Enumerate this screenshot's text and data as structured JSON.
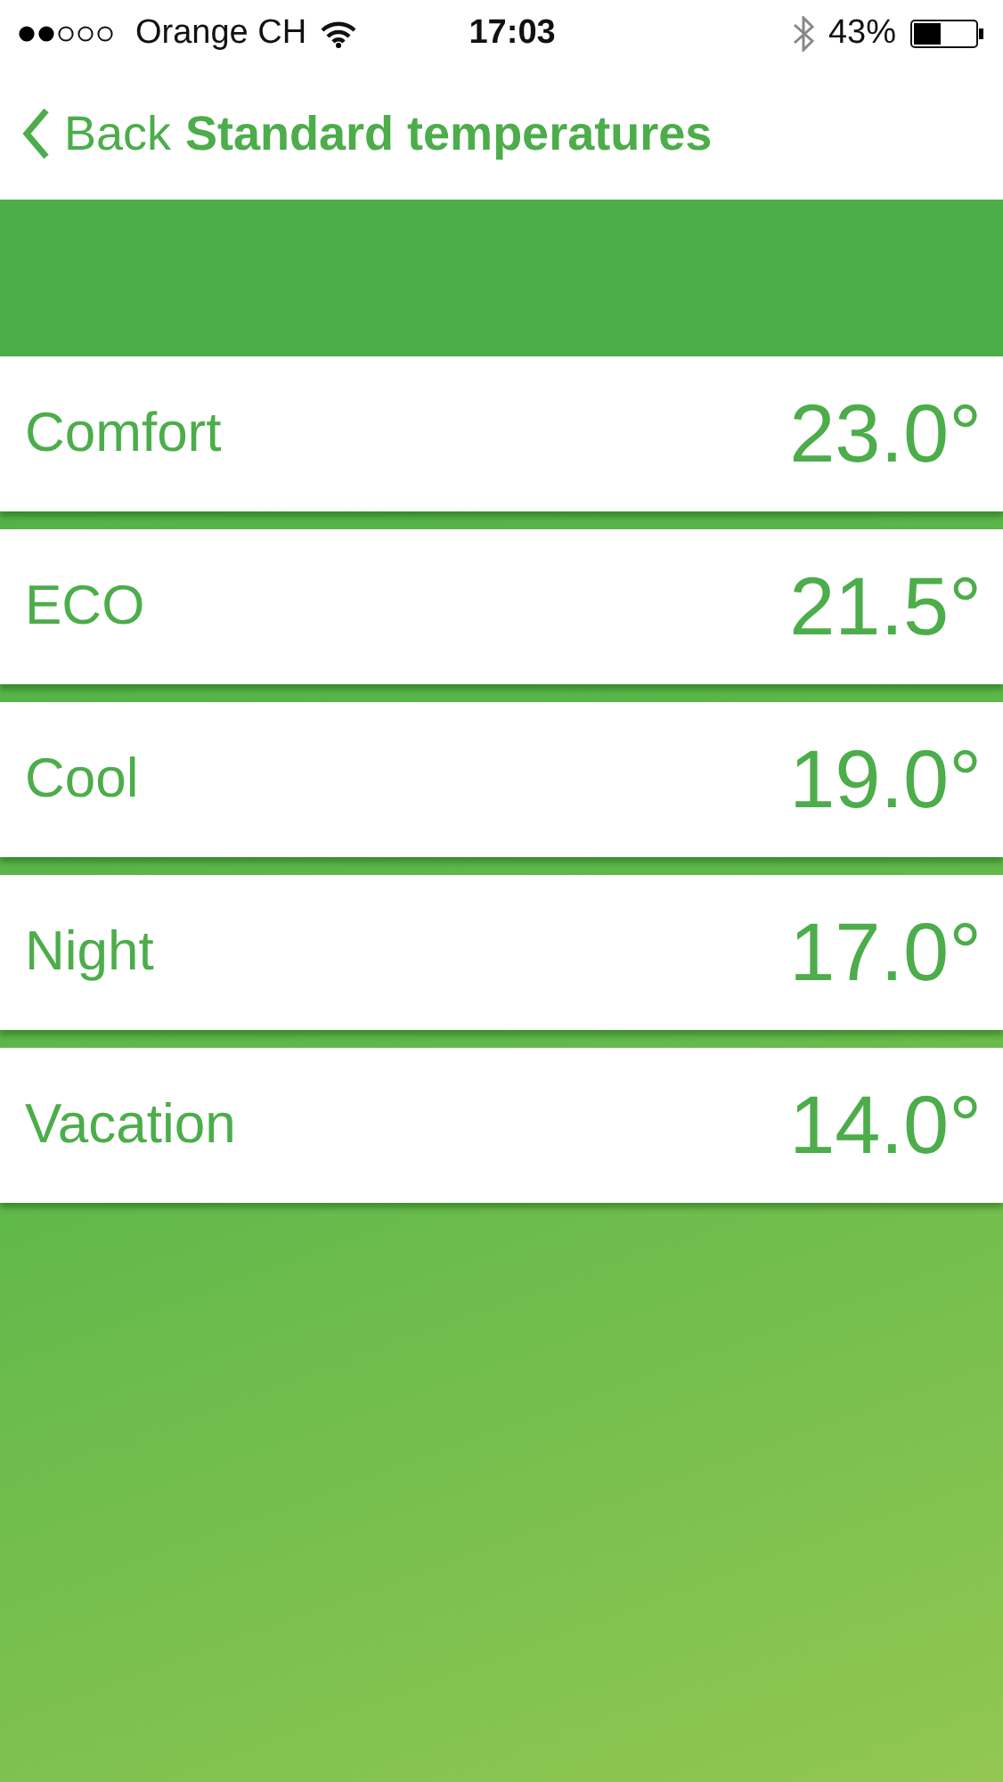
{
  "status_bar": {
    "carrier": "Orange CH",
    "time": "17:03",
    "battery": "43%"
  },
  "nav": {
    "back": "Back",
    "title": "Standard temperatures"
  },
  "temperatures": [
    {
      "name": "Comfort",
      "value": "23.0°"
    },
    {
      "name": "ECO",
      "value": "21.5°"
    },
    {
      "name": "Cool",
      "value": "19.0°"
    },
    {
      "name": "Night",
      "value": "17.0°"
    },
    {
      "name": "Vacation",
      "value": "14.0°"
    }
  ]
}
